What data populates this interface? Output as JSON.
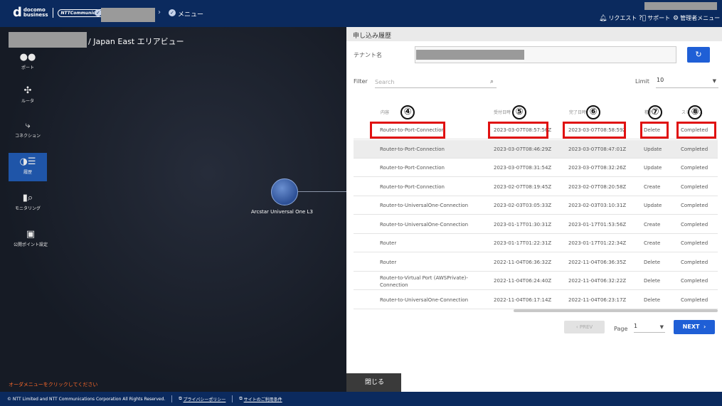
{
  "topbar": {
    "logo_mark": "d",
    "logo_text_1": "docomo",
    "logo_text_2": "business",
    "ntt_logo": "NTTCommunications",
    "menu_label": "メニュー",
    "request_label": "リクエスト",
    "support_label": "サポート",
    "admin_menu_label": "管理者メニュー"
  },
  "left": {
    "area_title": "/ Japan East エリアビュー",
    "side_items": [
      {
        "label": "ポート",
        "icon": "port-icon",
        "glyph": "●●"
      },
      {
        "label": "ルータ",
        "icon": "router-icon",
        "glyph": "✣"
      },
      {
        "label": "コネクション",
        "icon": "connection-icon",
        "glyph": "⤷"
      },
      {
        "label": "履歴",
        "icon": "history-icon",
        "glyph": "◑☰"
      },
      {
        "label": "モニタリング",
        "icon": "monitoring-icon",
        "glyph": "▮⌕"
      },
      {
        "label": "公開ポイント設定",
        "icon": "public-point-icon",
        "glyph": "▣"
      }
    ],
    "node_label": "Arcstar Universal One L3",
    "order_note": "オーダメニューをクリックしてください"
  },
  "panel": {
    "title": "申し込み履歴",
    "tenant_label": "テナント名",
    "refresh_glyph": "↻",
    "filter_label": "Filter",
    "search_placeholder": "Search",
    "limit_label": "Limit",
    "limit_value": "10",
    "columns": [
      "内容",
      "受付日時",
      "完了日時",
      "種別",
      "ステータス"
    ],
    "rows": [
      {
        "content": "Router-to-Port-Connection",
        "accepted": "2023-03-07T08:57:56Z",
        "completed": "2023-03-07T08:58:59Z",
        "type": "Delete",
        "status": "Completed"
      },
      {
        "content": "Router-to-Port-Connection",
        "accepted": "2023-03-07T08:46:29Z",
        "completed": "2023-03-07T08:47:01Z",
        "type": "Update",
        "status": "Completed"
      },
      {
        "content": "Router-to-Port-Connection",
        "accepted": "2023-03-07T08:31:54Z",
        "completed": "2023-03-07T08:32:26Z",
        "type": "Update",
        "status": "Completed"
      },
      {
        "content": "Router-to-Port-Connection",
        "accepted": "2023-02-07T08:19:45Z",
        "completed": "2023-02-07T08:20:58Z",
        "type": "Create",
        "status": "Completed"
      },
      {
        "content": "Router-to-UniversalOne-Connection",
        "accepted": "2023-02-03T03:05:33Z",
        "completed": "2023-02-03T03:10:31Z",
        "type": "Update",
        "status": "Completed"
      },
      {
        "content": "Router-to-UniversalOne-Connection",
        "accepted": "2023-01-17T01:30:31Z",
        "completed": "2023-01-17T01:53:56Z",
        "type": "Create",
        "status": "Completed"
      },
      {
        "content": "Router",
        "accepted": "2023-01-17T01:22:31Z",
        "completed": "2023-01-17T01:22:34Z",
        "type": "Create",
        "status": "Completed"
      },
      {
        "content": "Router",
        "accepted": "2022-11-04T06:36:32Z",
        "completed": "2022-11-04T06:36:35Z",
        "type": "Delete",
        "status": "Completed"
      },
      {
        "content": "Router-to-Virtual Port (AWSPrivate)-Connection",
        "accepted": "2022-11-04T06:24:40Z",
        "completed": "2022-11-04T06:32:22Z",
        "type": "Delete",
        "status": "Completed"
      },
      {
        "content": "Router-to-UniversalOne-Connection",
        "accepted": "2022-11-04T06:17:14Z",
        "completed": "2022-11-04T06:23:17Z",
        "type": "Delete",
        "status": "Completed"
      }
    ],
    "annotations": [
      "④",
      "⑤",
      "⑥",
      "⑦",
      "⑧"
    ],
    "prev_label": "PREV",
    "page_label": "Page",
    "page_value": "1",
    "next_label": "NEXT",
    "close_label": "閉じる"
  },
  "footer": {
    "copyright": "© NTT Limited and NTT Communications Corporation All Rights Reserved.",
    "privacy_label": "プライバシーポリシー",
    "terms_label": "サイトのご利用条件"
  }
}
